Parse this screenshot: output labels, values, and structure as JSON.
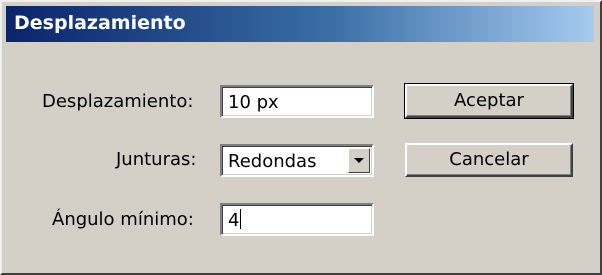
{
  "dialog": {
    "title": "Desplazamiento"
  },
  "fields": {
    "offset": {
      "label": "Desplazamiento:",
      "value": "10 px"
    },
    "joins": {
      "label": "Junturas:",
      "value": "Redondas"
    },
    "min_angle": {
      "label": "Ángulo mínimo:",
      "value": "4"
    }
  },
  "buttons": {
    "ok": "Aceptar",
    "cancel": "Cancelar"
  },
  "icons": {
    "dropdown": "chevron-down-icon"
  }
}
